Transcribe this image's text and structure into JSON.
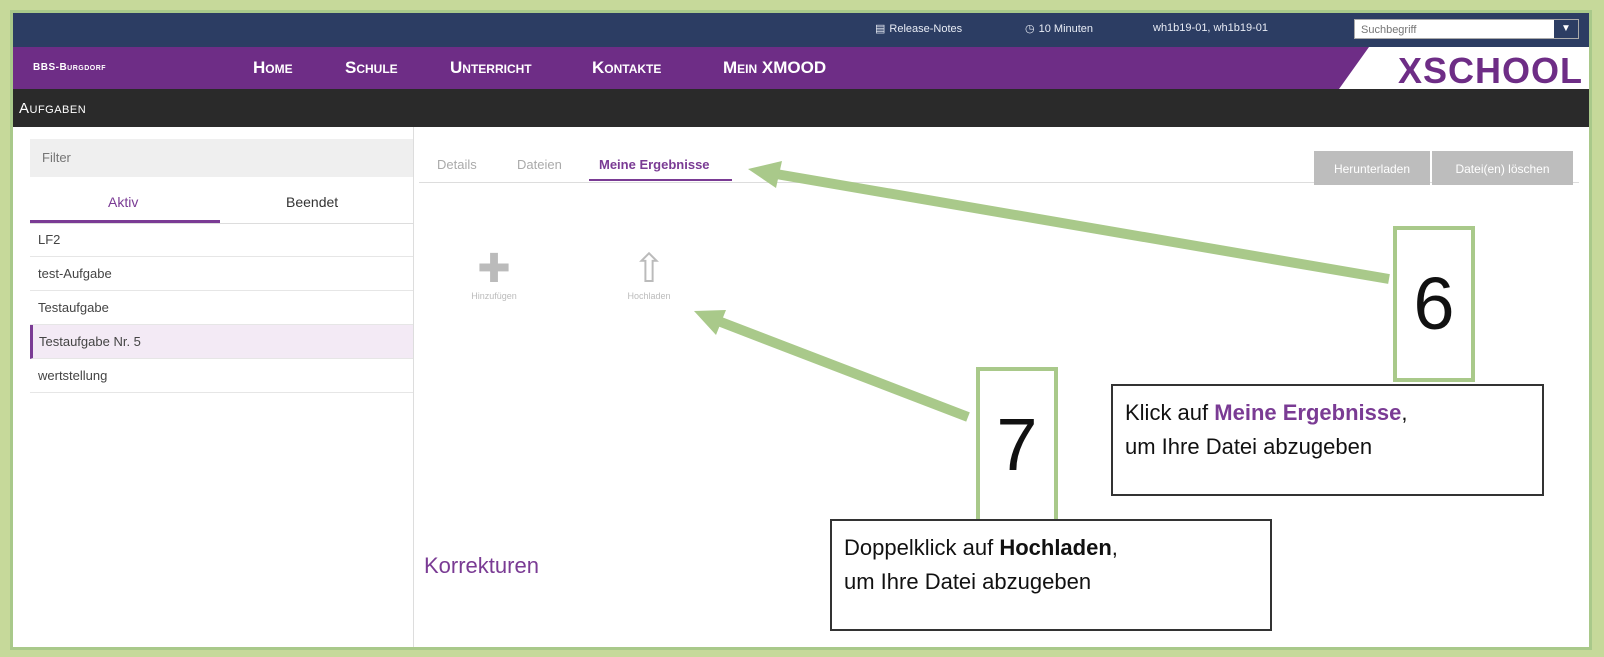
{
  "topbar": {
    "release_notes": "Release-Notes",
    "timer": "10 Minuten",
    "user": "wh1b19-01, wh1b19-01",
    "search_placeholder": "Suchbegriff"
  },
  "nav": {
    "brand": "BBS-Burgdorf",
    "links": [
      "Home",
      "Schule",
      "Unterricht",
      "Kontakte",
      "Mein XMOOD"
    ],
    "logo": "XSCHOOL"
  },
  "page_title": "Aufgaben",
  "sidebar": {
    "filter_placeholder": "Filter",
    "tabs": [
      "Aktiv",
      "Beendet"
    ],
    "items": [
      "LF2",
      "test-Aufgabe",
      "Testaufgabe",
      "Testaufgabe Nr. 5",
      "wertstellung"
    ]
  },
  "main": {
    "tabs": [
      "Details",
      "Dateien",
      "Meine Ergebnisse"
    ],
    "buttons": {
      "download": "Herunterladen",
      "delete": "Datei(en) löschen"
    },
    "actions": {
      "add": "Hinzufügen",
      "upload": "Hochladen"
    },
    "section_title": "Korrekturen"
  },
  "annotations": {
    "step6": {
      "number": "6",
      "pre": "Klick auf ",
      "highlight": "Meine Ergebnisse",
      "post": ",",
      "line2": "um Ihre Datei abzugeben"
    },
    "step7": {
      "number": "7",
      "pre": "Doppelklick auf ",
      "highlight": "Hochladen",
      "post": ",",
      "line2": "um Ihre Datei abzugeben"
    }
  },
  "colors": {
    "topbar": "#2c3d63",
    "nav": "#6e2d86",
    "accent": "#7a3b94",
    "annotation_green": "#a9c98a"
  }
}
